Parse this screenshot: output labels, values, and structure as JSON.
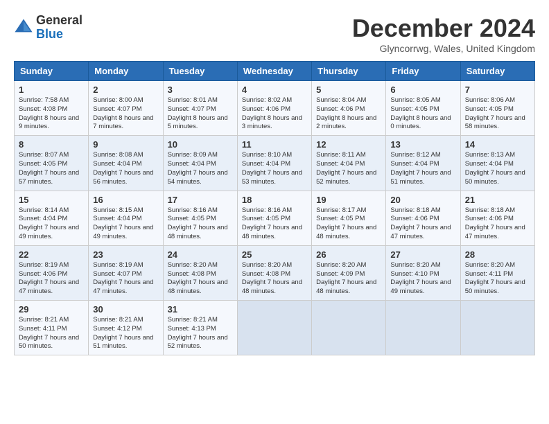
{
  "logo": {
    "general": "General",
    "blue": "Blue"
  },
  "title": "December 2024",
  "location": "Glyncorrwg, Wales, United Kingdom",
  "days_of_week": [
    "Sunday",
    "Monday",
    "Tuesday",
    "Wednesday",
    "Thursday",
    "Friday",
    "Saturday"
  ],
  "weeks": [
    [
      {
        "day": "1",
        "sunrise": "7:58 AM",
        "sunset": "4:08 PM",
        "daylight": "8 hours and 9 minutes."
      },
      {
        "day": "2",
        "sunrise": "8:00 AM",
        "sunset": "4:07 PM",
        "daylight": "8 hours and 7 minutes."
      },
      {
        "day": "3",
        "sunrise": "8:01 AM",
        "sunset": "4:07 PM",
        "daylight": "8 hours and 5 minutes."
      },
      {
        "day": "4",
        "sunrise": "8:02 AM",
        "sunset": "4:06 PM",
        "daylight": "8 hours and 3 minutes."
      },
      {
        "day": "5",
        "sunrise": "8:04 AM",
        "sunset": "4:06 PM",
        "daylight": "8 hours and 2 minutes."
      },
      {
        "day": "6",
        "sunrise": "8:05 AM",
        "sunset": "4:05 PM",
        "daylight": "8 hours and 0 minutes."
      },
      {
        "day": "7",
        "sunrise": "8:06 AM",
        "sunset": "4:05 PM",
        "daylight": "7 hours and 58 minutes."
      }
    ],
    [
      {
        "day": "8",
        "sunrise": "8:07 AM",
        "sunset": "4:05 PM",
        "daylight": "7 hours and 57 minutes."
      },
      {
        "day": "9",
        "sunrise": "8:08 AM",
        "sunset": "4:04 PM",
        "daylight": "7 hours and 56 minutes."
      },
      {
        "day": "10",
        "sunrise": "8:09 AM",
        "sunset": "4:04 PM",
        "daylight": "7 hours and 54 minutes."
      },
      {
        "day": "11",
        "sunrise": "8:10 AM",
        "sunset": "4:04 PM",
        "daylight": "7 hours and 53 minutes."
      },
      {
        "day": "12",
        "sunrise": "8:11 AM",
        "sunset": "4:04 PM",
        "daylight": "7 hours and 52 minutes."
      },
      {
        "day": "13",
        "sunrise": "8:12 AM",
        "sunset": "4:04 PM",
        "daylight": "7 hours and 51 minutes."
      },
      {
        "day": "14",
        "sunrise": "8:13 AM",
        "sunset": "4:04 PM",
        "daylight": "7 hours and 50 minutes."
      }
    ],
    [
      {
        "day": "15",
        "sunrise": "8:14 AM",
        "sunset": "4:04 PM",
        "daylight": "7 hours and 49 minutes."
      },
      {
        "day": "16",
        "sunrise": "8:15 AM",
        "sunset": "4:04 PM",
        "daylight": "7 hours and 49 minutes."
      },
      {
        "day": "17",
        "sunrise": "8:16 AM",
        "sunset": "4:05 PM",
        "daylight": "7 hours and 48 minutes."
      },
      {
        "day": "18",
        "sunrise": "8:16 AM",
        "sunset": "4:05 PM",
        "daylight": "7 hours and 48 minutes."
      },
      {
        "day": "19",
        "sunrise": "8:17 AM",
        "sunset": "4:05 PM",
        "daylight": "7 hours and 48 minutes."
      },
      {
        "day": "20",
        "sunrise": "8:18 AM",
        "sunset": "4:06 PM",
        "daylight": "7 hours and 47 minutes."
      },
      {
        "day": "21",
        "sunrise": "8:18 AM",
        "sunset": "4:06 PM",
        "daylight": "7 hours and 47 minutes."
      }
    ],
    [
      {
        "day": "22",
        "sunrise": "8:19 AM",
        "sunset": "4:06 PM",
        "daylight": "7 hours and 47 minutes."
      },
      {
        "day": "23",
        "sunrise": "8:19 AM",
        "sunset": "4:07 PM",
        "daylight": "7 hours and 47 minutes."
      },
      {
        "day": "24",
        "sunrise": "8:20 AM",
        "sunset": "4:08 PM",
        "daylight": "7 hours and 48 minutes."
      },
      {
        "day": "25",
        "sunrise": "8:20 AM",
        "sunset": "4:08 PM",
        "daylight": "7 hours and 48 minutes."
      },
      {
        "day": "26",
        "sunrise": "8:20 AM",
        "sunset": "4:09 PM",
        "daylight": "7 hours and 48 minutes."
      },
      {
        "day": "27",
        "sunrise": "8:20 AM",
        "sunset": "4:10 PM",
        "daylight": "7 hours and 49 minutes."
      },
      {
        "day": "28",
        "sunrise": "8:20 AM",
        "sunset": "4:11 PM",
        "daylight": "7 hours and 50 minutes."
      }
    ],
    [
      {
        "day": "29",
        "sunrise": "8:21 AM",
        "sunset": "4:11 PM",
        "daylight": "7 hours and 50 minutes."
      },
      {
        "day": "30",
        "sunrise": "8:21 AM",
        "sunset": "4:12 PM",
        "daylight": "7 hours and 51 minutes."
      },
      {
        "day": "31",
        "sunrise": "8:21 AM",
        "sunset": "4:13 PM",
        "daylight": "7 hours and 52 minutes."
      },
      null,
      null,
      null,
      null
    ]
  ],
  "labels": {
    "sunrise": "Sunrise:",
    "sunset": "Sunset:",
    "daylight": "Daylight"
  }
}
